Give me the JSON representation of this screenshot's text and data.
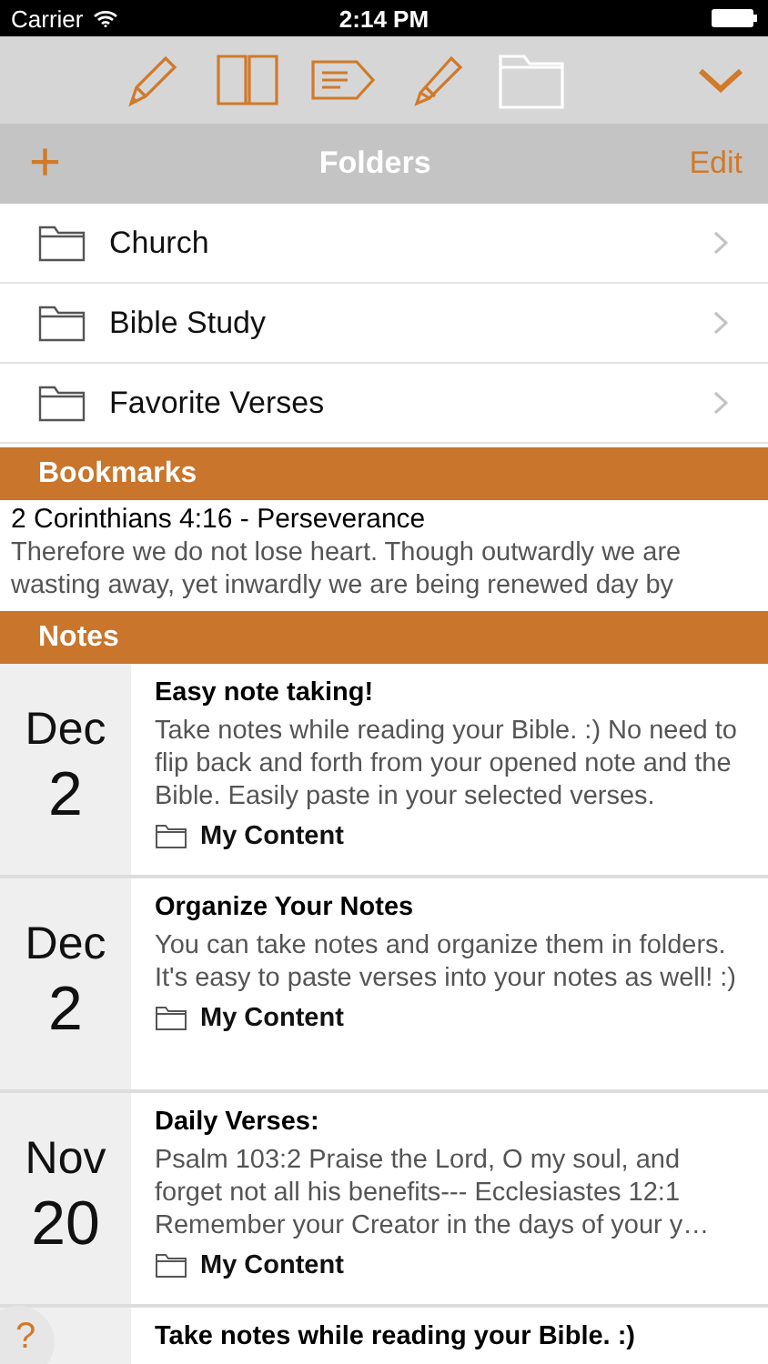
{
  "status_bar": {
    "carrier": "Carrier",
    "time": "2:14 PM"
  },
  "toolbar": [
    {
      "kind": "pencil",
      "selected": false
    },
    {
      "kind": "book",
      "selected": false
    },
    {
      "kind": "tag",
      "selected": false
    },
    {
      "kind": "highlighter",
      "selected": false
    },
    {
      "kind": "folder",
      "selected": true
    }
  ],
  "nav": {
    "title": "Folders",
    "add": "+",
    "edit": "Edit"
  },
  "folders": [
    {
      "name": "Church"
    },
    {
      "name": "Bible Study"
    },
    {
      "name": "Favorite Verses"
    }
  ],
  "bookmarks": {
    "header": "Bookmarks",
    "items": [
      {
        "title": "2 Corinthians 4:16 - Perseverance",
        "text": "Therefore we do not lose heart. Though outwardly we are wasting away, yet inwardly we are being renewed day by"
      }
    ]
  },
  "notes": {
    "header": "Notes",
    "items": [
      {
        "month": "Dec",
        "day": "2",
        "title": "Easy note taking!",
        "text": "Take notes while reading your Bible. :)   No need to flip back and forth from your opened note and the Bible. Easily paste in your selected verses.",
        "folder": "My Content"
      },
      {
        "month": "Dec",
        "day": "2",
        "title": "Organize Your Notes",
        "text": "You can take notes and organize them in folders. It's easy to paste verses into your notes as well! :)",
        "folder": "My Content"
      },
      {
        "month": "Nov",
        "day": "20",
        "title": "Daily Verses:",
        "text": "Psalm 103:2 Praise the Lord, O my soul, and forget not all his benefits---  Ecclesiastes 12:1 Remember your Creator in the days of your y…",
        "folder": "My Content"
      },
      {
        "title": "Take notes while reading your Bible. :)"
      }
    ]
  },
  "help": "?"
}
